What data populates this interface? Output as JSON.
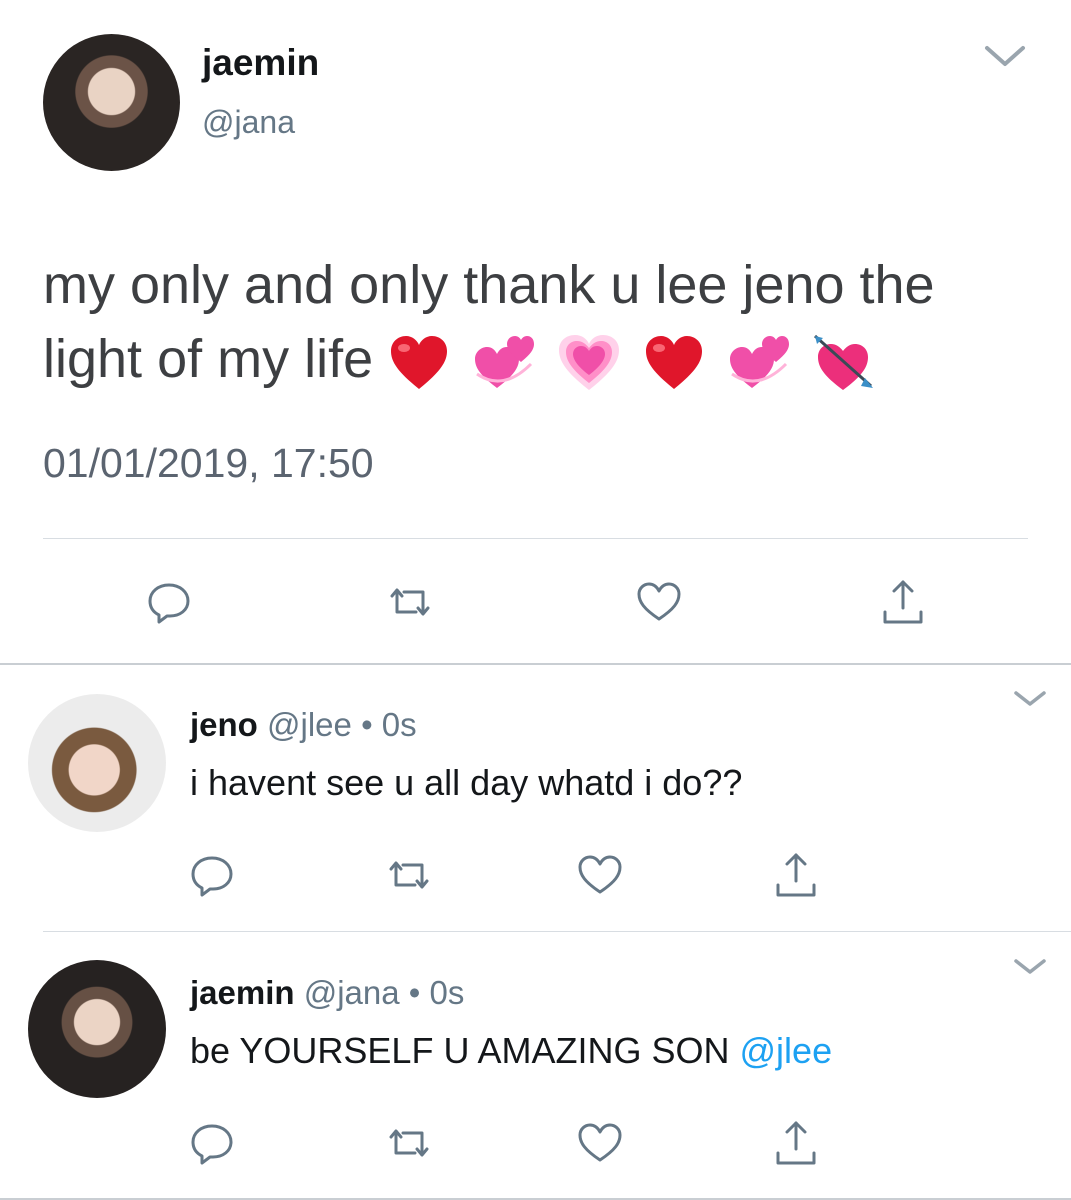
{
  "main_tweet": {
    "name": "jaemin",
    "handle": "@jana",
    "text": "my only and only thank u lee jeno the light of my life",
    "emojis": [
      "red-heart",
      "revolving-hearts",
      "growing-heart",
      "red-heart",
      "revolving-hearts",
      "heart-with-arrow"
    ],
    "timestamp": "01/01/2019, 17:50"
  },
  "replies": [
    {
      "name": "jeno",
      "handle": "@jlee",
      "separator": "•",
      "time": "0s",
      "text": "i havent see u all day whatd i do??",
      "mention": ""
    },
    {
      "name": "jaemin",
      "handle": "@jana",
      "separator": "•",
      "time": "0s",
      "text": "be YOURSELF U AMAZING SON",
      "mention": "@jlee"
    }
  ],
  "icons": {
    "reply": "reply-icon",
    "retweet": "retweet-icon",
    "like": "heart-icon",
    "share": "share-icon",
    "menu": "chevron-down-icon"
  },
  "colors": {
    "text": "#14171a",
    "secondary": "#657786",
    "mention": "#1da1f2",
    "heart_red": "#e0162b",
    "heart_pink": "#f04fa8"
  }
}
